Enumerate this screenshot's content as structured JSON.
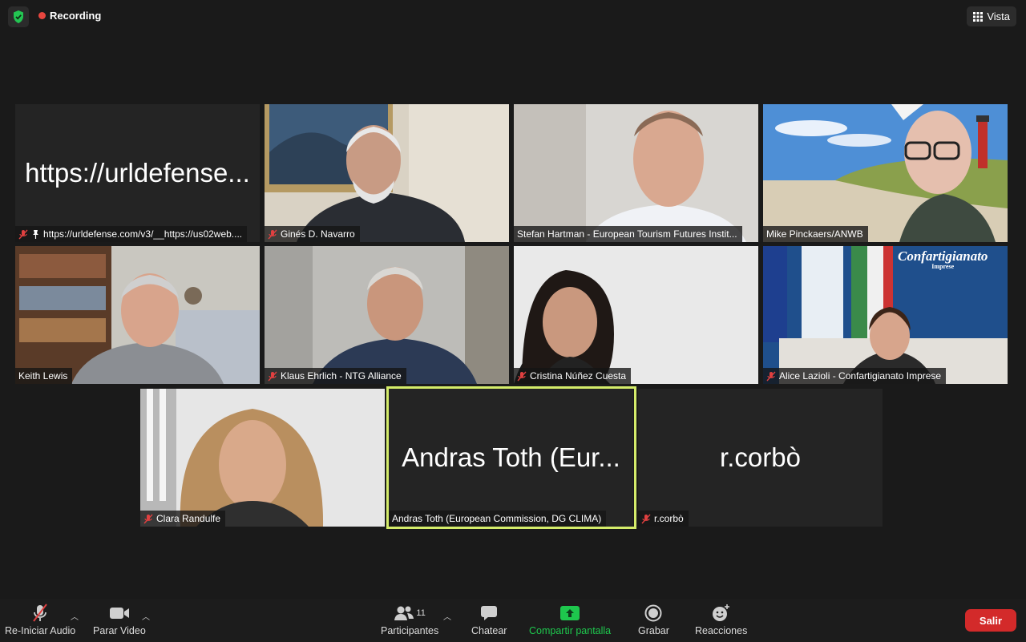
{
  "topbar": {
    "recording_label": "Recording",
    "view_label": "Vista"
  },
  "tiles": [
    {
      "big_text": "https://urldefense...",
      "name": "https://urldefense.com/v3/__https://us02web...."
    },
    {
      "name": "Ginés D. Navarro"
    },
    {
      "name": "Stefan Hartman - European Tourism Futures Instit..."
    },
    {
      "name": "Mike Pinckaers/ANWB"
    },
    {
      "name": "Keith Lewis"
    },
    {
      "name": "Klaus Ehrlich - NTG Alliance"
    },
    {
      "name": "Cristina Núñez Cuesta"
    },
    {
      "name": "Alice Lazioli - Confartigianato Imprese"
    },
    {
      "name": "Clara Randulfe"
    },
    {
      "big_text": "Andras Toth (Eur...",
      "name": "Andras Toth (European Commission, DG CLIMA)"
    },
    {
      "big_text": "r.corbò",
      "name": "r.corbò"
    }
  ],
  "confartigianato": {
    "logo_text": "Confartigianato",
    "logo_sub": "Imprese"
  },
  "toolbar": {
    "audio_label": "Re-Iniciar Audio",
    "video_label": "Parar Video",
    "participants_label": "Participantes",
    "participants_count": "11",
    "chat_label": "Chatear",
    "share_label": "Compartir pantalla",
    "record_label": "Grabar",
    "reactions_label": "Reacciones",
    "leave_label": "Salir"
  },
  "colors": {
    "active_speaker_border": "#d4ec6a",
    "leave_button": "#d32a2a",
    "share_green": "#1ec74d",
    "recording_dot": "#e8463f"
  }
}
